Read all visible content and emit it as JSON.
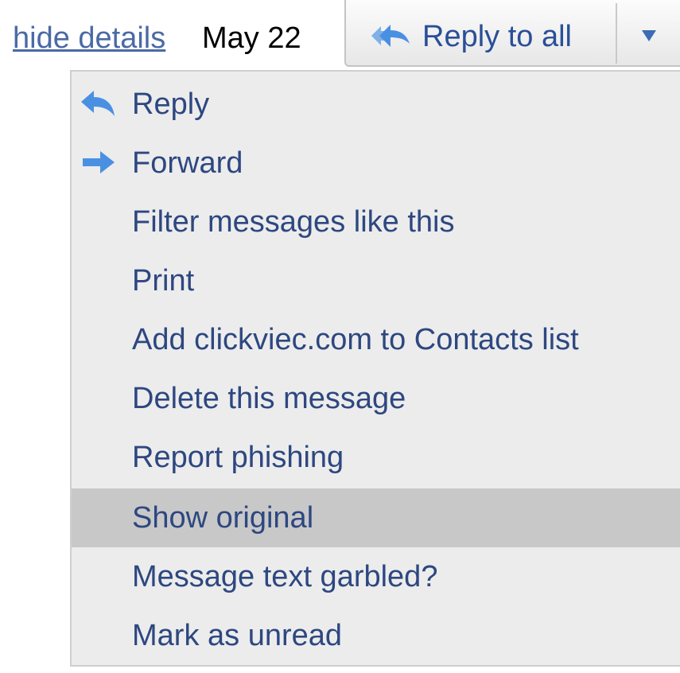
{
  "header": {
    "hide_details": "hide details",
    "date": "May 22",
    "reply_all_label": "Reply to all"
  },
  "colors": {
    "link": "#4a6aa5",
    "menu_text": "#2d4780",
    "icon_blue": "#4a90e2",
    "highlight": "#c8c8c8",
    "menu_bg": "#ececec"
  },
  "menu": {
    "items": [
      {
        "label": "Reply",
        "icon": "reply-arrow-icon"
      },
      {
        "label": "Forward",
        "icon": "forward-arrow-icon"
      },
      {
        "label": "Filter messages like this"
      },
      {
        "label": "Print"
      },
      {
        "label": "Add clickviec.com to Contacts list"
      },
      {
        "label": "Delete this message"
      },
      {
        "label": "Report phishing"
      },
      {
        "label": "Show original",
        "highlighted": true
      },
      {
        "label": "Message text garbled?"
      },
      {
        "label": "Mark as unread"
      }
    ]
  }
}
